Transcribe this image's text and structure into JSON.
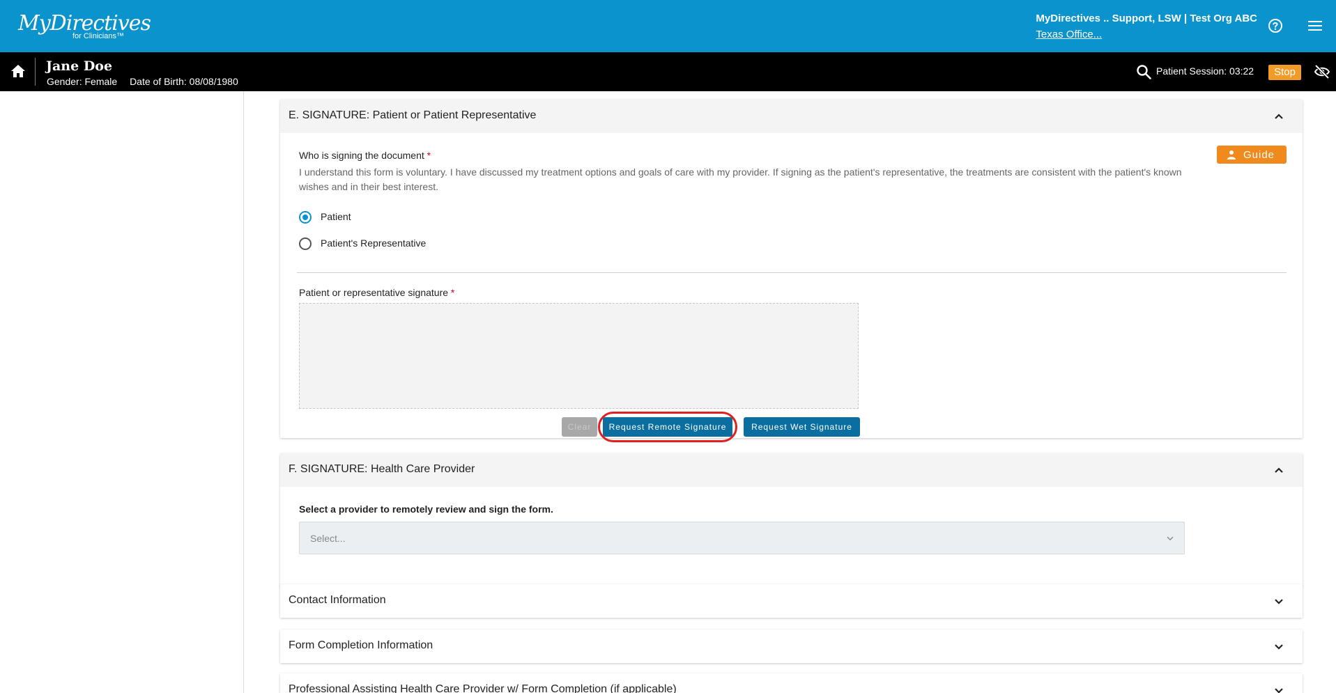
{
  "header": {
    "brand": "MyDirectives",
    "brand_sub": "for Clinicians™",
    "user": "MyDirectives .. Support, LSW | Test Org ABC",
    "office": "Texas Office...",
    "colors": {
      "primary": "#0a93cd",
      "accent": "#f29b27"
    },
    "icons": [
      "help-icon",
      "menu-icon"
    ]
  },
  "patient_bar": {
    "name": "Jane Doe",
    "gender": "Gender: Female",
    "dob": "Date of Birth: 08/08/1980",
    "session": "Patient Session: 03:22",
    "stop_label": "Stop",
    "icons": [
      "home-icon",
      "search-icon",
      "eye-off-icon"
    ]
  },
  "section_e": {
    "title": "E. SIGNATURE: Patient or Patient Representative",
    "guide_label": "Guide",
    "who_label": "Who is signing the document",
    "required_mark": "*",
    "hint": "I understand this form is voluntary. I have discussed my treatment options and goals of care with my provider. If signing as the patient's representative, the treatments are consistent with the patient's known wishes and in their best interest.",
    "options": [
      {
        "label": "Patient",
        "checked": true
      },
      {
        "label": "Patient's Representative",
        "checked": false
      }
    ],
    "signature_label": "Patient or representative signature",
    "buttons": {
      "clear": "Clear",
      "remote": "Request Remote Signature",
      "wet": "Request Wet Signature"
    }
  },
  "section_f": {
    "title": "F. SIGNATURE: Health Care Provider",
    "provider_label": "Select a provider to remotely review and sign the form.",
    "select_placeholder": "Select..."
  },
  "collapsed_sections": [
    "Contact Information",
    "Form Completion Information",
    "Professional Assisting Health Care Provider w/ Form Completion (if applicable)"
  ]
}
